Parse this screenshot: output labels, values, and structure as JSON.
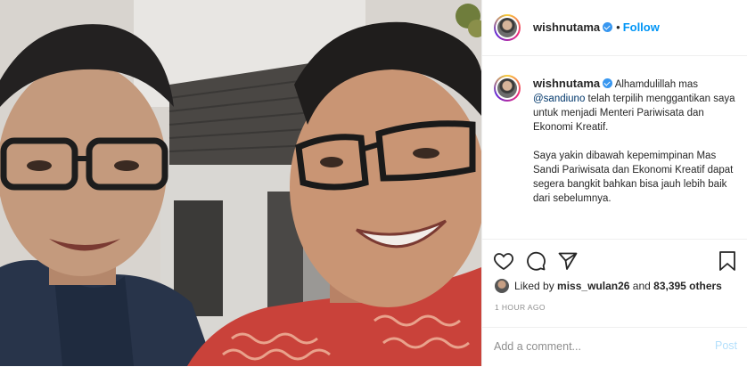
{
  "post": {
    "username": "wishnutama",
    "follow_label": "Follow",
    "separator": "•"
  },
  "caption": {
    "username": "wishnutama",
    "paragraph1_text": "Alhamdulillah mas ",
    "mention": "@sandiuno",
    "paragraph1_rest": " telah terpilih menggantikan saya untuk menjadi Menteri Pariwisata dan Ekonomi Kreatif.",
    "paragraph2": "Saya yakin dibawah kepemimpinan Mas Sandi Pariwisata dan Ekonomi Kreatif dapat segera bangkit bahkan bisa jauh lebih baik dari sebelumnya."
  },
  "engagement": {
    "liked_prefix": "Liked by",
    "liked_user": "miss_wulan26",
    "liked_and": "and",
    "liked_others": "83,395 others",
    "timestamp": "1 HOUR AGO"
  },
  "comment": {
    "placeholder": "Add a comment...",
    "post_label": "Post"
  },
  "icons": {
    "like": "heart-icon",
    "comment": "comment-icon",
    "share": "share-icon",
    "save": "bookmark-icon",
    "verified": "verified-badge-icon"
  },
  "colors": {
    "follow": "#0095f6",
    "verified": "#3897f0",
    "post_disabled": "#b2dffc",
    "mention": "#00376b"
  }
}
